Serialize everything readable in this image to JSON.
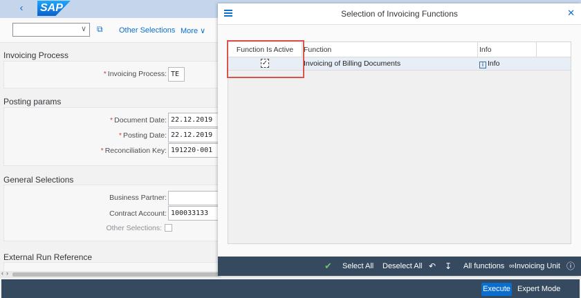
{
  "shell": {
    "back_icon": "chevron-left-icon",
    "logo_text": "SAP"
  },
  "toolbar": {
    "variant_value": "",
    "other_selections": "Other Selections",
    "more": "More"
  },
  "sections": {
    "invoicing_process": "Invoicing Process",
    "posting_params": "Posting params",
    "general_selections": "General Selections",
    "external_run_reference": "External Run Reference"
  },
  "fields": {
    "invoicing_process": {
      "label": "Invoicing Process:",
      "value": "TE"
    },
    "document_date": {
      "label": "Document Date:",
      "value": "22.12.2019"
    },
    "posting_date": {
      "label": "Posting Date:",
      "value": "22.12.2019"
    },
    "reconciliation_key": {
      "label": "Reconciliation Key:",
      "value": "191220-001"
    },
    "business_partner": {
      "label": "Business Partner:",
      "value": ""
    },
    "contract_account": {
      "label": "Contract Account:",
      "value": "100033133"
    },
    "other_selections": {
      "label": "Other Selections:",
      "checked": false
    }
  },
  "footer": {
    "execute": "Execute",
    "expert_mode": "Expert Mode"
  },
  "dialog": {
    "title": "Selection of Invoicing Functions",
    "columns": {
      "active": "Function Is Active",
      "function": "Function",
      "info": "Info"
    },
    "rows": [
      {
        "active": true,
        "function": "Invoicing of Billing Documents",
        "info": "Info"
      }
    ],
    "footer": {
      "select_all": "Select All",
      "deselect_all": "Deselect All",
      "all_functions": "All functions",
      "invoicing_unit": "Invoicing Unit"
    }
  },
  "colors": {
    "shell": "#c5d6ec",
    "footer": "#354a5f",
    "accent": "#0a6ed1",
    "highlight": "#d9534f"
  }
}
